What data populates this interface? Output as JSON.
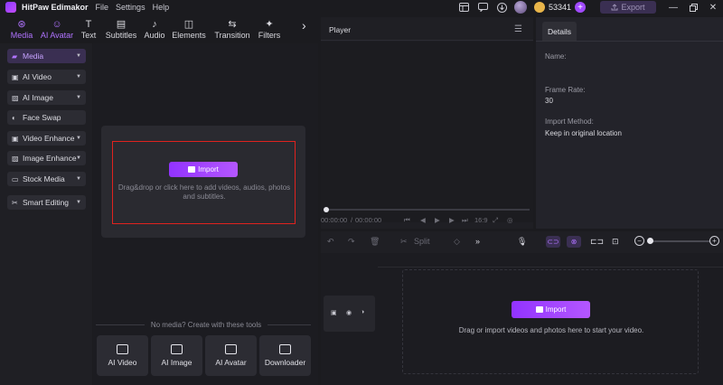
{
  "titlebar": {
    "app_title": "HitPaw Edimakor",
    "menu": [
      "File",
      "Settings",
      "Help"
    ],
    "credits": "53341",
    "export_label": "Export",
    "icons": [
      "layout-icon",
      "feedback-icon",
      "download-icon"
    ]
  },
  "toolbar": {
    "tabs": [
      {
        "label": "Media",
        "icon": "media-icon",
        "active": true
      },
      {
        "label": "AI Avatar",
        "icon": "ai-avatar-icon",
        "active": true
      },
      {
        "label": "Text",
        "icon": "text-icon"
      },
      {
        "label": "Subtitles",
        "icon": "subtitles-icon"
      },
      {
        "label": "Audio",
        "icon": "audio-icon"
      },
      {
        "label": "Elements",
        "icon": "elements-icon"
      },
      {
        "label": "Transition",
        "icon": "transition-icon"
      },
      {
        "label": "Filters",
        "icon": "filters-icon"
      }
    ]
  },
  "sidebar": {
    "items": [
      {
        "label": "Media",
        "icon": "folder-icon"
      },
      {
        "label": "AI Video",
        "icon": "ai-video-icon"
      },
      {
        "label": "AI Image",
        "icon": "ai-image-icon"
      },
      {
        "label": "Face Swap",
        "icon": "face-swap-icon"
      },
      {
        "label": "Video Enhance",
        "icon": "video-enhance-icon"
      },
      {
        "label": "Image Enhance",
        "icon": "image-enhance-icon"
      },
      {
        "label": "Stock Media",
        "icon": "stock-media-icon"
      },
      {
        "label": "Smart Editing",
        "icon": "smart-editing-icon"
      }
    ]
  },
  "media": {
    "import_label": "Import",
    "drop_text": "Drag&drop or click here to add videos, audios, photos and subtitles.",
    "no_media_text": "No media? Create with these tools",
    "tools": [
      "AI Video",
      "AI Image",
      "AI Avatar",
      "Downloader"
    ]
  },
  "player": {
    "title": "Player",
    "current_time": "00:00:00",
    "total_time": "00:00:00",
    "aspect": "16:9"
  },
  "details": {
    "tab": "Details",
    "name_label": "Name:",
    "frame_rate_label": "Frame Rate:",
    "frame_rate_value": "30",
    "import_method_label": "Import Method:",
    "import_method_value": "Keep in original location"
  },
  "timeline": {
    "split_label": "Split",
    "import_label": "Import",
    "drop_text": "Drag or import videos and photos here to start your video.",
    "zoom_level": 0
  },
  "colors": {
    "accent": "#a24bff",
    "highlight_border": "#e0221e",
    "background": "#1b1b1f"
  }
}
